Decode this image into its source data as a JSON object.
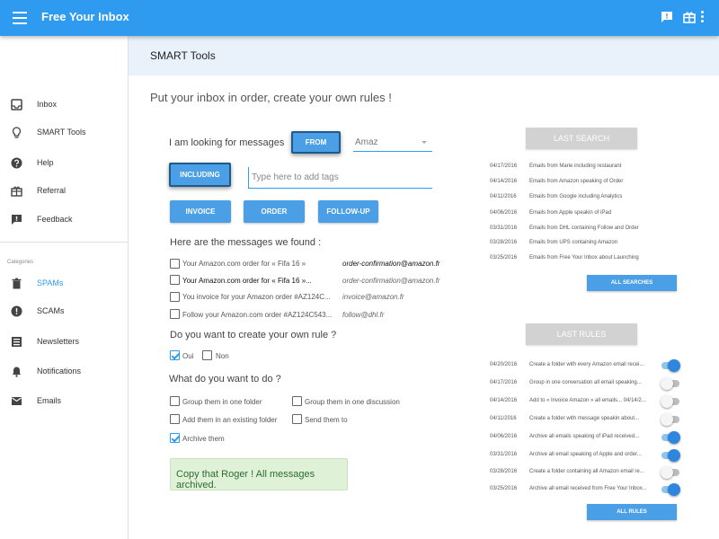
{
  "app": {
    "title": "Free Your Inbox"
  },
  "sidebar": {
    "items": [
      {
        "label": "Inbox",
        "icon": "inbox-icon"
      },
      {
        "label": "SMART Tools",
        "icon": "lightbulb-icon"
      },
      {
        "label": "Help",
        "icon": "help-icon"
      },
      {
        "label": "Referral",
        "icon": "gift-icon"
      },
      {
        "label": "Feedback",
        "icon": "feedback-icon"
      }
    ],
    "categories_label": "Categories",
    "categories": [
      {
        "label": "SPAMs",
        "icon": "trash-icon",
        "active": true
      },
      {
        "label": "SCAMs",
        "icon": "alert-icon"
      },
      {
        "label": "Newsletters",
        "icon": "newsletter-icon"
      },
      {
        "label": "Notifications",
        "icon": "bell-icon"
      },
      {
        "label": "Emails",
        "icon": "mail-icon"
      }
    ]
  },
  "section": {
    "title": "SMART Tools"
  },
  "main": {
    "heading": "Put your inbox in order, create your own rules !",
    "looking_for": "I am looking for messages",
    "from_button": "FROM",
    "from_value": "Amaz",
    "including_button": "INCLUDING",
    "tags_placeholder": "Type here to add tags",
    "quick_tags": [
      "INVOICE",
      "ORDER",
      "FOLLOW-UP"
    ],
    "found_heading": "Here are the messages we found :",
    "messages": [
      {
        "subject": "Your Amazon.com order for « Fifa 16 »",
        "sender": "order-confirmation@amazon.fr",
        "bold": false
      },
      {
        "subject": "Your Amazon.com order for « Fifa 16 »...",
        "sender": "order-confirmation@amazon.fr",
        "bold": true
      },
      {
        "subject": "You invoice for your Amazon order #AZ124C...",
        "sender": "invoice@amazon.fr",
        "bold": false
      },
      {
        "subject": "Follow your Amazon.com order #AZ124C543...",
        "sender": "follow@dhl.fr",
        "bold": false
      }
    ],
    "rule_question": "Do you want to create your own rule ?",
    "rule_options": [
      {
        "label": "Oui",
        "checked": true
      },
      {
        "label": "Non",
        "checked": false
      }
    ],
    "action_question": "What do you want to do ?",
    "actions": [
      {
        "label": "Group them in one folder",
        "checked": false
      },
      {
        "label": "Group them in one discussion",
        "checked": false
      },
      {
        "label": "Add them in an existing folder",
        "checked": false
      },
      {
        "label": "Send them to",
        "checked": false
      },
      {
        "label": "Archive them",
        "checked": true
      }
    ],
    "success_message": "Copy that Roger ! All messages archived."
  },
  "last_search": {
    "button": "LAST SEARCH",
    "rows": [
      {
        "date": "04/17/2016",
        "text": "Emails from Marie including restaurant"
      },
      {
        "date": "04/14/2016",
        "text": "Emails from Amazon speaking of Order"
      },
      {
        "date": "04/11/2016",
        "text": "Emails from Google including Analytics"
      },
      {
        "date": "04/06/2016",
        "text": "Emails from Apple speakin of iPad"
      },
      {
        "date": "03/31/2016",
        "text": "Emails from DHL containing Follow and Order"
      },
      {
        "date": "03/28/2016",
        "text": "Emails from UPS containing Amazon"
      },
      {
        "date": "03/25/2016",
        "text": "Emails from Free Your Inbox about Launching"
      }
    ],
    "all_button": "ALL SEARCHES"
  },
  "last_rules": {
    "button": "LAST RULES",
    "rows": [
      {
        "date": "04/20/2016",
        "text": "Create a folder with every Amazon email recei...",
        "enabled": true
      },
      {
        "date": "04/17/2016",
        "text": "Group in one conversation all email speaking...",
        "enabled": false
      },
      {
        "date": "04/14/2016",
        "text": "Add to « Invoice Amazon » all emails... 04/14/2...",
        "enabled": false
      },
      {
        "date": "04/11/2016",
        "text": "Create a folder with message speakin about...",
        "enabled": false
      },
      {
        "date": "04/06/2016",
        "text": "Archive all emails speaking of iPad received...",
        "enabled": true
      },
      {
        "date": "03/31/2016",
        "text": "Archive all email speaking of Apple and order...",
        "enabled": true
      },
      {
        "date": "03/28/2016",
        "text": "Create a folder containing all Amazon email re...",
        "enabled": false
      },
      {
        "date": "03/25/2016",
        "text": "Archive all email received from Free Your Inbox...",
        "enabled": true
      }
    ],
    "all_button": "ALL RULES"
  },
  "colors": {
    "primary": "#2e9bf0",
    "button": "#4a9fe6",
    "success_bg": "#dff2d8",
    "header_strip": "#e9f2fb"
  }
}
